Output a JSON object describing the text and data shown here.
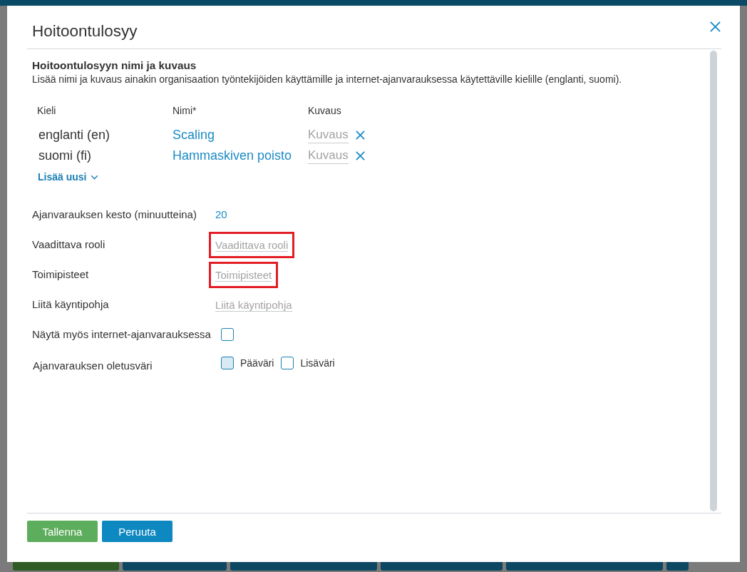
{
  "dialog": {
    "title": "Hoitoontulosyy"
  },
  "section": {
    "title": "Hoitoontulosyyn nimi ja kuvaus",
    "description": "Lisää nimi ja kuvaus ainakin organisaation työntekijöiden käyttämille ja internet-ajanvarauksessa käytettäville kielille (englanti, suomi)."
  },
  "languages": {
    "columns": [
      "Kieli",
      "Nimi*",
      "Kuvaus"
    ],
    "rows": [
      {
        "language": "englanti (en)",
        "name": "Scaling",
        "placeholder": "Kuvaus"
      },
      {
        "language": "suomi (fi)",
        "name": "Hammaskiven poisto",
        "placeholder": "Kuvaus"
      }
    ],
    "add_link": "Lisää uusi"
  },
  "form": {
    "rows": [
      {
        "kind": "value",
        "label": "Ajanvarauksen kesto (minuutteina)",
        "value": "20"
      },
      {
        "kind": "field",
        "label": "Vaadittava rooli",
        "placeholder": "Vaadittava rooli",
        "highlighted": true
      },
      {
        "kind": "field",
        "label": "Toimipisteet",
        "placeholder": "Toimipisteet",
        "highlighted": true
      },
      {
        "kind": "field",
        "label": "Liitä käyntipohja",
        "placeholder": "Liitä käyntipohja",
        "highlighted": false
      },
      {
        "kind": "checkbox",
        "label": "Näytä myös internet-ajanvarauksessa",
        "checked": false
      },
      {
        "kind": "colors",
        "label": "Ajanvarauksen oletusväri",
        "options": [
          {
            "label": "Pääväri",
            "color": "#d8eaf3"
          },
          {
            "label": "Lisäväri",
            "color": "#ffffff"
          }
        ]
      }
    ]
  },
  "buttons": [
    {
      "kind": "primary",
      "label": "Tallenna"
    },
    {
      "kind": "secondary",
      "label": "Peruuta"
    }
  ]
}
